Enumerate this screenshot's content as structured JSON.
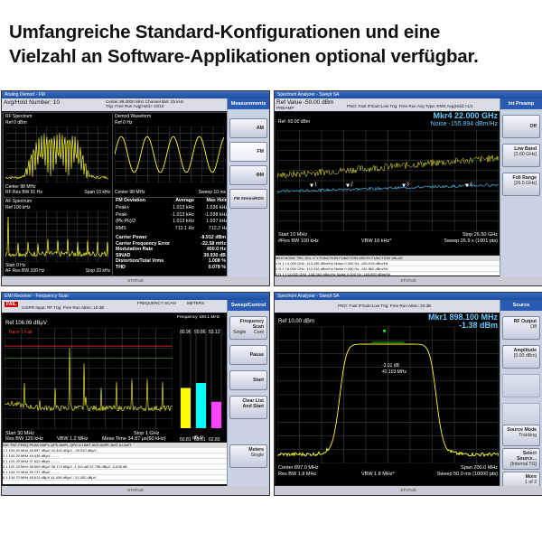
{
  "headline": {
    "line1": "Umfangreiche Standard-Konfigurationen und eine",
    "line2": "Vielzahl an Software-Applikationen optional verfügbar."
  },
  "colors": {
    "trace_yellow": "#ffff33",
    "trace_cyan": "#55ccff",
    "bar_yellow": "#ffff00",
    "bar_cyan": "#00ffff",
    "bar_magenta": "#ff44ff",
    "softkey_header": "#2a5bb2"
  },
  "analog": {
    "title": "Analog Demod - FM",
    "info1": "Avg/Hold Number: 10",
    "info2": "Center 98.0000 MHz  Channel BW: 25 kHz",
    "info3": "Trig: Free Run   Avg|Hold> 10/10",
    "info4": "Atten: 10 dB",
    "softkeys": {
      "header": "Measurements",
      "am": "AM",
      "fm": "FM",
      "phim": "ΦM",
      "fm_stereo": "FM Stereo/RDS"
    },
    "rf": {
      "name": "RF Spectrum",
      "ref": "Ref  0 dBm",
      "center": "Center  98 MHz",
      "res_bw": "RF Res BW  91 Hz",
      "span": "Span 10 kHz"
    },
    "demod": {
      "name": "Demod Waveform",
      "ref": "Ref  0 Hz",
      "center": "Center  98 MHz",
      "sweep": "Sweep  10 ms"
    },
    "af": {
      "name": "AF Spectrum",
      "ref": "Ref  100 kHz",
      "start": "Start  0 Hz",
      "res_bw": "AF Res BW  100 Hz",
      "stop": "Stop 20 kHz"
    },
    "fm_dev": {
      "title": "FM Deviation",
      "avg_head": "Average",
      "max_head": "Max Hold",
      "rows": [
        {
          "label": "Peak+",
          "avg": "1.013 kHz",
          "max": "1.036 kHz"
        },
        {
          "label": "Peak-",
          "avg": "-1.013 kHz",
          "max": "-1.038 kHz"
        },
        {
          "label": "(Pk-Pk)/2",
          "avg": "1.013 kHz",
          "max": "1.037 kHz"
        },
        {
          "label": "RMS",
          "avg": "712.1 Hz",
          "max": "712.2 Hz"
        }
      ],
      "results": [
        {
          "label": "Carrier Power",
          "value": "-8.912 dBm"
        },
        {
          "label": "Carrier Frequency Error",
          "value": "-22.58 mHz"
        },
        {
          "label": "Modulation Rate",
          "value": "400.0 Hz"
        },
        {
          "label": "SINAD",
          "value": "39.930 dB"
        },
        {
          "label": "Distortion/Total Vrms",
          "value": "1.008 %"
        },
        {
          "label": "THD",
          "value": "0.078 %"
        }
      ]
    },
    "status": "STATUS"
  },
  "swept": {
    "title": "Spectrum Analyzer - Swept SA",
    "ref_value": "Ref Value -50.00 dBm",
    "info": "PNO: Fast   IFGain:Low    Trig: Free Run   Avg Type: RMS   Avg|Hold:>1/1",
    "preamp": "PREAMP",
    "marker": "Mkr4  22.000 GHz",
    "noise": "Noise -155.894 dBm/Hz",
    "ref_plot": "Ref -50.00 dBm",
    "start": "Start 10 MHz",
    "res_bw": "#Res BW 100 kHz",
    "vbw": "VBW 10 kHz*",
    "stop": "Stop 26.50 GHz",
    "sweep": "Sweep  26.9 s (1001 pts)",
    "softkeys": {
      "header": "Int Preamp",
      "off": "Off",
      "low_band": "Low Band",
      "low_band_sub": "[3.60 GHz]",
      "full_range": "Full Range",
      "full_range_sub": "[26.5 GHz]"
    },
    "marker_table_head": [
      "MKR",
      "MODE",
      "TRC",
      "SCL",
      "X",
      "Y",
      "FUNCTION",
      "FUNCTION WIDTH",
      "FUNCTION VALUE"
    ],
    "marker_rows": [
      [
        "1",
        "N",
        "1",
        "f",
        "4.000 GHz",
        "-113.196 dBm/Hz",
        "Noise",
        "0.000 Hz",
        "-160.019 dBm/Hz"
      ],
      [
        "2",
        "N",
        "1",
        "f",
        "8.000 GHz",
        "-112.416 dBm/Hz",
        "Noise",
        "0.000 Hz",
        "-162.862 dBm/Hz"
      ],
      [
        "3",
        "N",
        "1",
        "f",
        "14.000 GHz",
        "-106.563 dBm/Hz",
        "Noise",
        "0.000 Hz",
        "-160.850 dBm/Hz"
      ],
      [
        "4",
        "N",
        "1",
        "f",
        "22.000 GHz",
        "-106.661 dBm/Hz",
        "Noise",
        "0.000 Hz",
        "-155.894 dBm/Hz"
      ]
    ],
    "status": "STATUS"
  },
  "emi": {
    "title": "EMI Receiver - Frequency Scan",
    "fail": "FAIL",
    "info": "CISPR   Input: RF   Trig: Free Run   Atten: 10 dB",
    "scan": "FREQUENCY SCAN",
    "meters": "METERS",
    "ref": "Ref 106.99 dBμV",
    "trace_label": "Trace 1 Fail",
    "meter_freq": "Frequency 100.1 MHz",
    "meter_vals": [
      "80.96",
      "90.86",
      "53.12"
    ],
    "meter_bottom": [
      "50.81",
      "60.61",
      "62.83"
    ],
    "meter_unit": "dBμV",
    "start": "Start 30 MHz",
    "res_bw": "Res BW 120 kHz",
    "vbw": "VBW 1.2 MHz",
    "meas_time": "Meas Time 34.87 μs(60 kHz)",
    "stop": "Stop 1 GHz",
    "softkeys": {
      "header": "Sweep/Control",
      "freq_scan": "Frequency Scan",
      "freq_scan_sub": "Cont",
      "single": "Single",
      "pause": "Pause",
      "start": "Start",
      "clear": "Clear List And Start",
      "meters": "Meters",
      "meters_sub": "Single"
    },
    "table_head": [
      "SIG",
      "TRC",
      "FREQ",
      "PEAK AMPL",
      "QPD AMPL",
      "QPD Δ LIMIT",
      "AVG AMPL",
      "AVG Δ LIMIT"
    ],
    "table_rows": [
      [
        "1",
        "1",
        "100.20 MHz",
        "46.557 dBμV",
        "44.402 dBμV",
        "-",
        "29.510 dBμV",
        "-"
      ],
      [
        "2",
        "1",
        "100.20 MHz",
        "49.436 dBμV",
        "-",
        "-",
        "-",
        "-"
      ],
      [
        "3",
        "1",
        "122.29 MHz",
        "37.622 dBμV",
        "-",
        "-",
        "-",
        "-"
      ],
      [
        "4",
        "1",
        "122.29 MHz",
        "38.669 dBμV",
        "36.172 dBμV",
        "-1.311 dB",
        "22.756 dBμV",
        "-3.628 dB"
      ],
      [
        "5",
        "1",
        "134.70 MHz",
        "39.737 dBμV",
        "-",
        "-",
        "-",
        "-"
      ],
      [
        "6",
        "1",
        "134.70 MHz",
        "45.911 dBμV",
        "41.456 dBμV",
        "-",
        "31.452 dBμV",
        "-"
      ]
    ],
    "status": "STATUS"
  },
  "occ": {
    "title": "Spectrum Analyzer - Swept SA",
    "info": "PNO: Fast   IFGain:Low   Trig: Free Run   Atten: 20 dB",
    "ref": "Ref 10.00 dBm",
    "marker": "Mkr1  898.100 MHz",
    "marker_val": "-1.38 dBm",
    "annot1": "-3.01 dB",
    "annot2": "42.153 MHz",
    "center": "Center 897.0 MHz",
    "res_bw": "Res BW 1.8 MHz",
    "vbw": "VBW 1.8 MHz*",
    "span": "Span 200.0 MHz",
    "sweep": "Sweep  50.0 ms (10000 pts)",
    "softkeys": {
      "header": "Source",
      "rf_output": "RF Output",
      "rf_output_sub": "Off",
      "amplitude": "Amplitude",
      "amplitude_sub": "[0.00 dBm]",
      "source_mode": "Source Mode",
      "source_mode_sub": "Tracking",
      "select_source": "Select Source...",
      "select_source_sub": "[Internal TG]",
      "more": "More",
      "more_sub": "1 of 2"
    },
    "status": "STATUS"
  }
}
